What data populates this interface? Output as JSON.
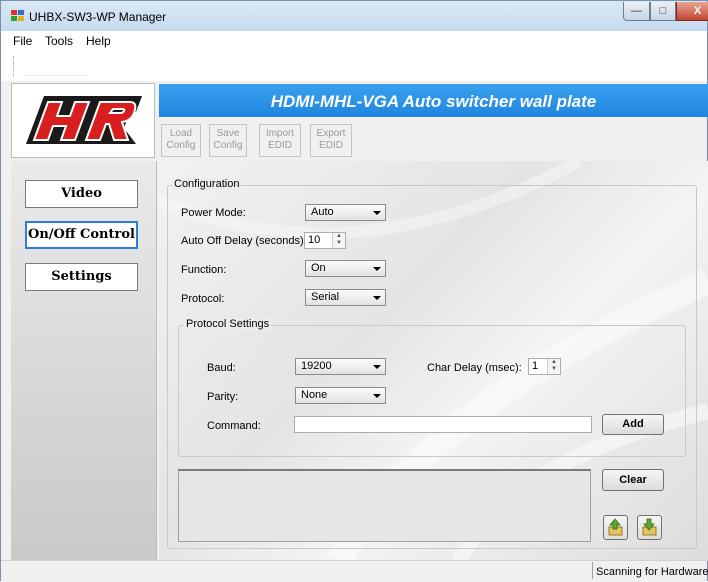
{
  "window": {
    "title": "UHBX-SW3-WP Manager",
    "min_glyph": "—",
    "max_glyph": "□",
    "close_glyph": "X"
  },
  "menu": {
    "items": [
      "File",
      "Tools",
      "Help"
    ]
  },
  "logo": {
    "text": "HR"
  },
  "banner": {
    "title": "HDMI-MHL-VGA Auto switcher wall plate"
  },
  "toolbar": {
    "load": [
      "Load",
      "Config"
    ],
    "save": [
      "Save",
      "Config"
    ],
    "import": [
      "Import",
      "EDID"
    ],
    "export": [
      "Export",
      "EDID"
    ]
  },
  "nav": {
    "video": "Video",
    "onoff": "On/Off Control",
    "settings": "Settings",
    "selected": "On/Off Control"
  },
  "config": {
    "title": "Configuration",
    "power_mode_label": "Power Mode:",
    "power_mode_value": "Auto",
    "auto_off_label": "Auto Off Delay (seconds):",
    "auto_off_value": "10",
    "function_label": "Function:",
    "function_value": "On",
    "protocol_label": "Protocol:",
    "protocol_value": "Serial"
  },
  "protocol_settings": {
    "title": "Protocol Settings",
    "baud_label": "Baud:",
    "baud_value": "19200",
    "char_delay_label": "Char Delay (msec):",
    "char_delay_value": "1",
    "parity_label": "Parity:",
    "parity_value": "None",
    "command_label": "Command:",
    "command_value": "",
    "add_label": "Add"
  },
  "log": {
    "clear_label": "Clear"
  },
  "status": {
    "text": "Scanning for Hardware ..."
  },
  "colors": {
    "banner": "#2a90e6",
    "logo_red": "#d81e1e",
    "selected_border": "#2a7dd8"
  }
}
